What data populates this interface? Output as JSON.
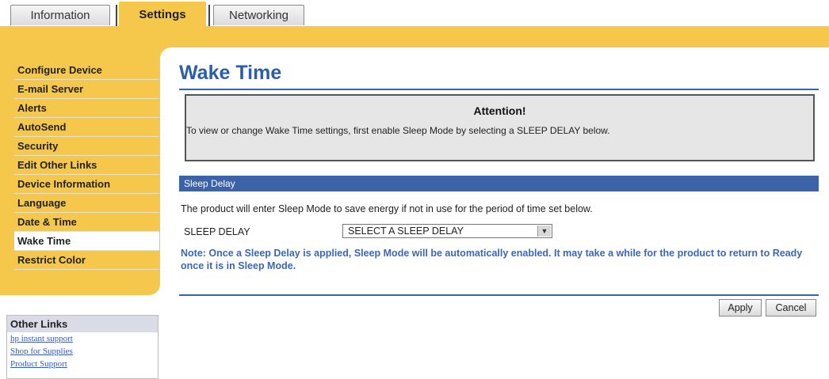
{
  "tabs": [
    {
      "label": "Information",
      "active": false
    },
    {
      "label": "Settings",
      "active": true
    },
    {
      "label": "Networking",
      "active": false
    }
  ],
  "sidebar": {
    "items": [
      {
        "label": "Configure Device"
      },
      {
        "label": "E-mail Server"
      },
      {
        "label": "Alerts"
      },
      {
        "label": "AutoSend"
      },
      {
        "label": "Security"
      },
      {
        "label": "Edit Other Links"
      },
      {
        "label": "Device Information"
      },
      {
        "label": "Language"
      },
      {
        "label": "Date & Time"
      },
      {
        "label": "Wake Time",
        "active": true
      },
      {
        "label": "Restrict Color"
      }
    ]
  },
  "other_links": {
    "header": "Other Links",
    "links": [
      "hp instant support",
      "Shop for Supplies",
      "Product Support"
    ]
  },
  "main": {
    "title": "Wake Time",
    "attention": {
      "title": "Attention!",
      "text": "To view or change Wake Time settings, first enable Sleep Mode by selecting a SLEEP DELAY below."
    },
    "section_title": "Sleep Delay",
    "description": "The product will enter Sleep Mode to save energy if not in use for the period of time set below.",
    "sleep_delay": {
      "label": "SLEEP DELAY",
      "selected": "SELECT A SLEEP DELAY"
    },
    "note": "Note: Once a Sleep Delay is applied, Sleep Mode will be automatically enabled. It may take a while for the product to return to Ready once it is in Sleep Mode."
  },
  "buttons": {
    "apply": "Apply",
    "cancel": "Cancel"
  },
  "colors": {
    "accent_yellow": "#f5c84c",
    "header_blue": "#3c63a8",
    "title_blue": "#2a5ea8",
    "note_blue": "#3a68b8"
  }
}
